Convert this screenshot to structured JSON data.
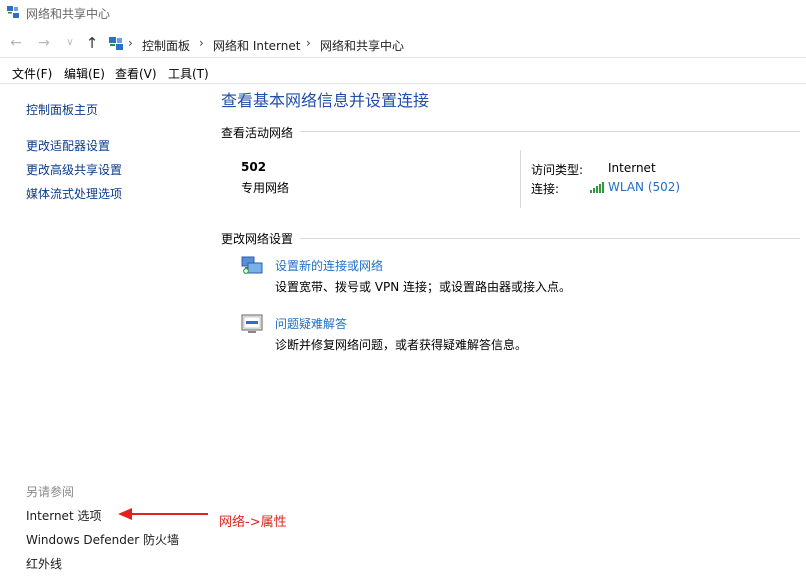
{
  "window": {
    "title": "网络和共享中心"
  },
  "address": {
    "crumbs": [
      "控制面板",
      "网络和 Internet",
      "网络和共享中心"
    ]
  },
  "menu": [
    "文件(F)",
    "编辑(E)",
    "查看(V)",
    "工具(T)"
  ],
  "sidebar": {
    "home": "控制面板主页",
    "links": [
      "更改适配器设置",
      "更改高级共享设置",
      "媒体流式处理选项"
    ],
    "see_also_label": "另请参阅",
    "see_also": [
      "Internet 选项",
      "Windows Defender 防火墙",
      "红外线"
    ]
  },
  "main": {
    "title": "查看基本网络信息并设置连接",
    "active_networks_label": "查看活动网络",
    "network": {
      "name": "502",
      "type": "专用网络",
      "access_label": "访问类型:",
      "access_value": "Internet",
      "connection_label": "连接:",
      "connection_value": "WLAN (502)"
    },
    "change_settings_label": "更改网络设置",
    "tasks": [
      {
        "link": "设置新的连接或网络",
        "desc": "设置宽带、拨号或 VPN 连接；或设置路由器或接入点。",
        "icon": "new-connection-icon"
      },
      {
        "link": "问题疑难解答",
        "desc": "诊断并修复网络问题，或者获得疑难解答信息。",
        "icon": "troubleshoot-icon"
      }
    ]
  },
  "annotation": {
    "text": "网络->属性",
    "color": "#e0231c"
  }
}
